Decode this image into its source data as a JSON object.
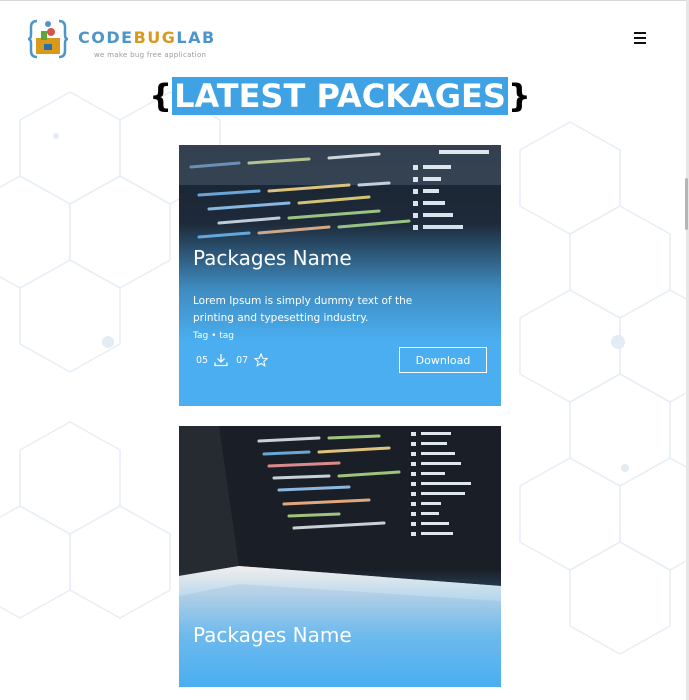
{
  "brand": {
    "name_part1": "CODE",
    "name_part2": "BUG",
    "name_part3": "LAB",
    "tagline": "we make bug free application"
  },
  "header": {
    "menu_icon": "hamburger-icon"
  },
  "section": {
    "open_brace": "{",
    "title": "LATEST PACKAGES",
    "close_brace": "}"
  },
  "packages": [
    {
      "name": "Packages Name",
      "description": "Lorem Ipsum is simply dummy text of the printing and typesetting industry.",
      "tags": "Tag • tag",
      "downloads": "05",
      "stars": "07",
      "download_label": "Download"
    },
    {
      "name": "Packages Name"
    }
  ],
  "colors": {
    "accent": "#3ea2e4",
    "card_gradient_bottom": "#4aaef0",
    "logo_blue": "#4e95c9",
    "logo_orange": "#d99a1c"
  },
  "icons": [
    "download-icon",
    "star-icon",
    "hamburger-icon"
  ]
}
